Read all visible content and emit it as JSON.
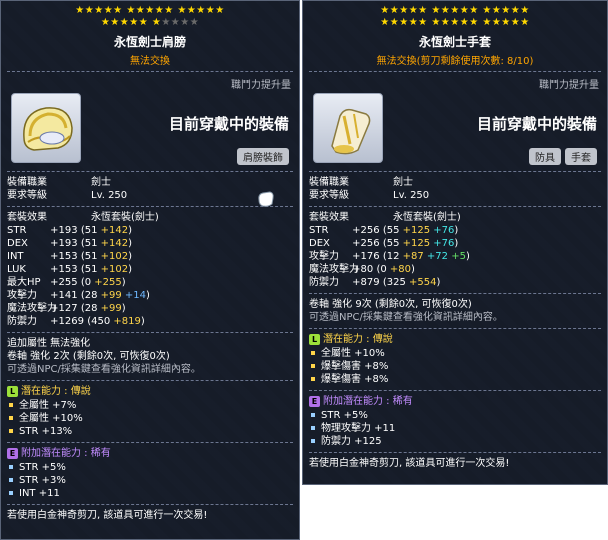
{
  "left": {
    "stars_rows": [
      {
        "bright": 15,
        "dim": 0
      },
      {
        "bright": 6,
        "dim": 4
      }
    ],
    "title": "永恆劍士肩膀",
    "subtitle": "無法交換",
    "job_power": "職鬥力提升量",
    "equipped": "目前穿戴中的裝備",
    "tags": [
      "肩膀裝飾"
    ],
    "job_label": "裝備職業",
    "job_value": "劍士",
    "level_label": "要求等級",
    "level_value": "Lv. 250",
    "set_label": "套裝效果",
    "set_value": "永恆套裝(劍士)",
    "stats": [
      {
        "n": "STR",
        "v": "+193",
        "base": "(51",
        "add": "+142",
        "end": ")"
      },
      {
        "n": "DEX",
        "v": "+193",
        "base": "(51",
        "add": "+142",
        "end": ")"
      },
      {
        "n": "INT",
        "v": "+153",
        "base": "(51",
        "add": "+102",
        "end": ")"
      },
      {
        "n": "LUK",
        "v": "+153",
        "base": "(51",
        "add": "+102",
        "end": ")"
      },
      {
        "n": "最大HP",
        "v": "+255",
        "base": "(0",
        "add": "+255",
        "end": ")"
      },
      {
        "n": "攻擊力",
        "v": "+141",
        "base": "(28",
        "add": "+99",
        "add2": "+14",
        "end": ")"
      },
      {
        "n": "魔法攻擊力",
        "v": "+127",
        "base": "(28",
        "add": "+99",
        "end": ")"
      },
      {
        "n": "防禦力",
        "v": "+1269",
        "base": "(450",
        "add": "+819",
        "end": ")"
      }
    ],
    "extra_attr": "追加屬性 無法強化",
    "scroll": "卷軸 強化 2次 (剩餘0次, 可恢復0次)",
    "npc_note": "可透過NPC/採集鍵查看強化資訊詳細內容。",
    "potential_header": "潛在能力 : 傳說",
    "potential_lines": [
      "全屬性 +7%",
      "全屬性 +10%",
      "STR +13%"
    ],
    "add_potential_header": "附加潛在能力 : 稀有",
    "add_potential_lines": [
      "STR +5%",
      "STR +3%",
      "INT +11"
    ],
    "footer": "若使用白金神奇剪刀, 該道具可進行一次交易!"
  },
  "right": {
    "stars_rows": [
      {
        "bright": 15,
        "dim": 0
      },
      {
        "bright": 15,
        "dim": 0
      }
    ],
    "title": "永恆劍士手套",
    "subtitle": "無法交換(剪刀剩餘使用次數: 8/10)",
    "job_power": "職鬥力提升量",
    "equipped": "目前穿戴中的裝備",
    "tags": [
      "防具",
      "手套"
    ],
    "job_label": "裝備職業",
    "job_value": "劍士",
    "level_label": "要求等級",
    "level_value": "Lv. 250",
    "set_label": "套裝效果",
    "set_value": "永恆套裝(劍士)",
    "stats": [
      {
        "n": "STR",
        "v": "+256",
        "base": "(55",
        "add": "+125",
        "add2": "+76",
        "end": ")"
      },
      {
        "n": "DEX",
        "v": "+256",
        "base": "(55",
        "add": "+125",
        "add2": "+76",
        "end": ")"
      },
      {
        "n": "攻擊力",
        "v": "+176",
        "base": "(12",
        "add": "+87",
        "add2": "+72",
        "add3": "+5",
        "end": ")"
      },
      {
        "n": "魔法攻擊力",
        "v": "+80",
        "base": "(0",
        "add": "+80",
        "end": ")"
      },
      {
        "n": "防禦力",
        "v": "+879",
        "base": "(325",
        "add": "+554",
        "end": ")"
      }
    ],
    "scroll": "卷軸 強化 9次 (剩餘0次, 可恢復0次)",
    "npc_note": "可透過NPC/採集鍵查看強化資訊詳細內容。",
    "potential_header": "潛在能力 : 傳說",
    "potential_lines": [
      "全屬性 +10%",
      "爆擊傷害 +8%",
      "爆擊傷害 +8%"
    ],
    "add_potential_header": "附加潛在能力 : 稀有",
    "add_potential_lines": [
      "STR +5%",
      "物理攻擊力 +11",
      "防禦力 +125"
    ],
    "footer": "若使用白金神奇剪刀, 該道具可進行一次交易!"
  },
  "colors": {
    "gold": "#ffd54a",
    "cyan": "#44e6e6",
    "green": "#66e066",
    "orange": "#ffa500",
    "legendary": "#9ce03a",
    "rare": "#b070e8"
  }
}
